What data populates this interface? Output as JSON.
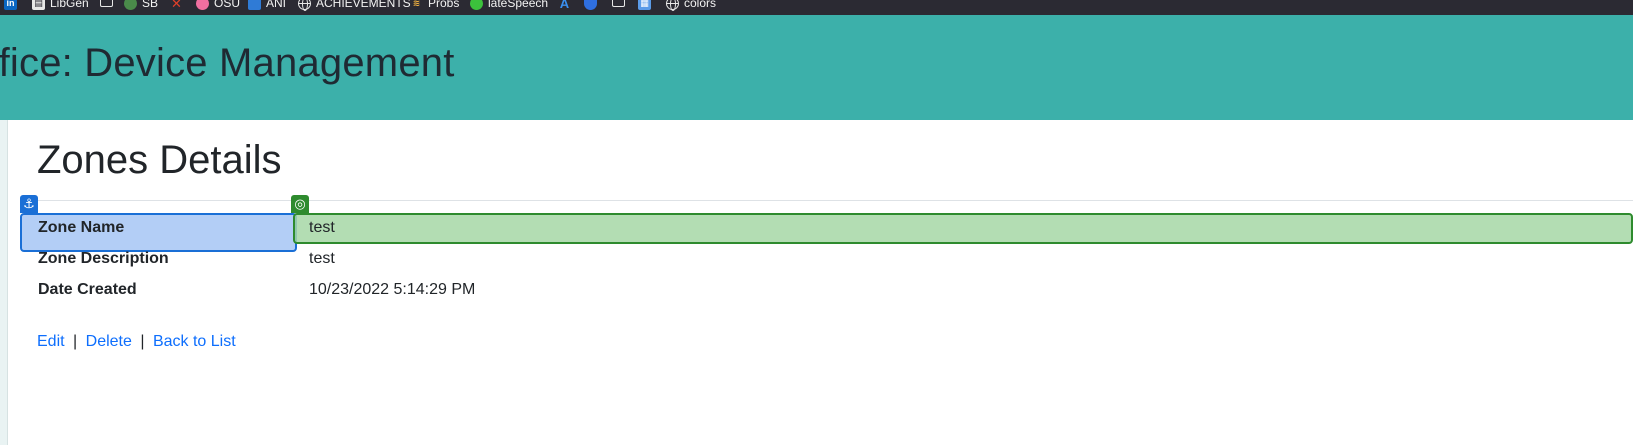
{
  "bookmarks": [
    {
      "label": "",
      "icon": "linkedin-icon"
    },
    {
      "label": "LibGen",
      "icon": "book-icon"
    },
    {
      "label": "",
      "icon": "folder-icon"
    },
    {
      "label": "SB",
      "icon": "globe-icon"
    },
    {
      "label": "",
      "icon": "x-icon"
    },
    {
      "label": "OSU",
      "icon": "osu-icon"
    },
    {
      "label": "ANI",
      "icon": "ani-icon"
    },
    {
      "label": "ACHIEVEMENTS",
      "icon": "globe-icon"
    },
    {
      "label": "Probs",
      "icon": "probs-icon"
    },
    {
      "label": "lateSpeech",
      "icon": "leaf-icon"
    },
    {
      "label": "",
      "icon": "azure-icon"
    },
    {
      "label": "",
      "icon": "shield-icon"
    },
    {
      "label": "",
      "icon": "folder-icon"
    },
    {
      "label": "",
      "icon": "calendar-icon"
    },
    {
      "label": "colors",
      "icon": "globe-icon"
    }
  ],
  "header": {
    "title": "ffice: Device Management"
  },
  "page": {
    "heading": "Zones Details"
  },
  "details": [
    {
      "label": "Zone Name",
      "value": "test"
    },
    {
      "label": "Zone Description",
      "value": "test"
    },
    {
      "label": "Date Created",
      "value": "10/23/2022 5:14:29 PM"
    }
  ],
  "actions": {
    "edit": "Edit",
    "delete": "Delete",
    "back": "Back to List",
    "separator": "|"
  },
  "overlay": {
    "anchor_glyph": "⚓",
    "target_glyph": "◎"
  },
  "colors": {
    "header_bg": "#3cb0aa",
    "link": "#0d6efd",
    "overlay_blue": "#1a6fd6",
    "overlay_green": "#2e8b2e"
  }
}
